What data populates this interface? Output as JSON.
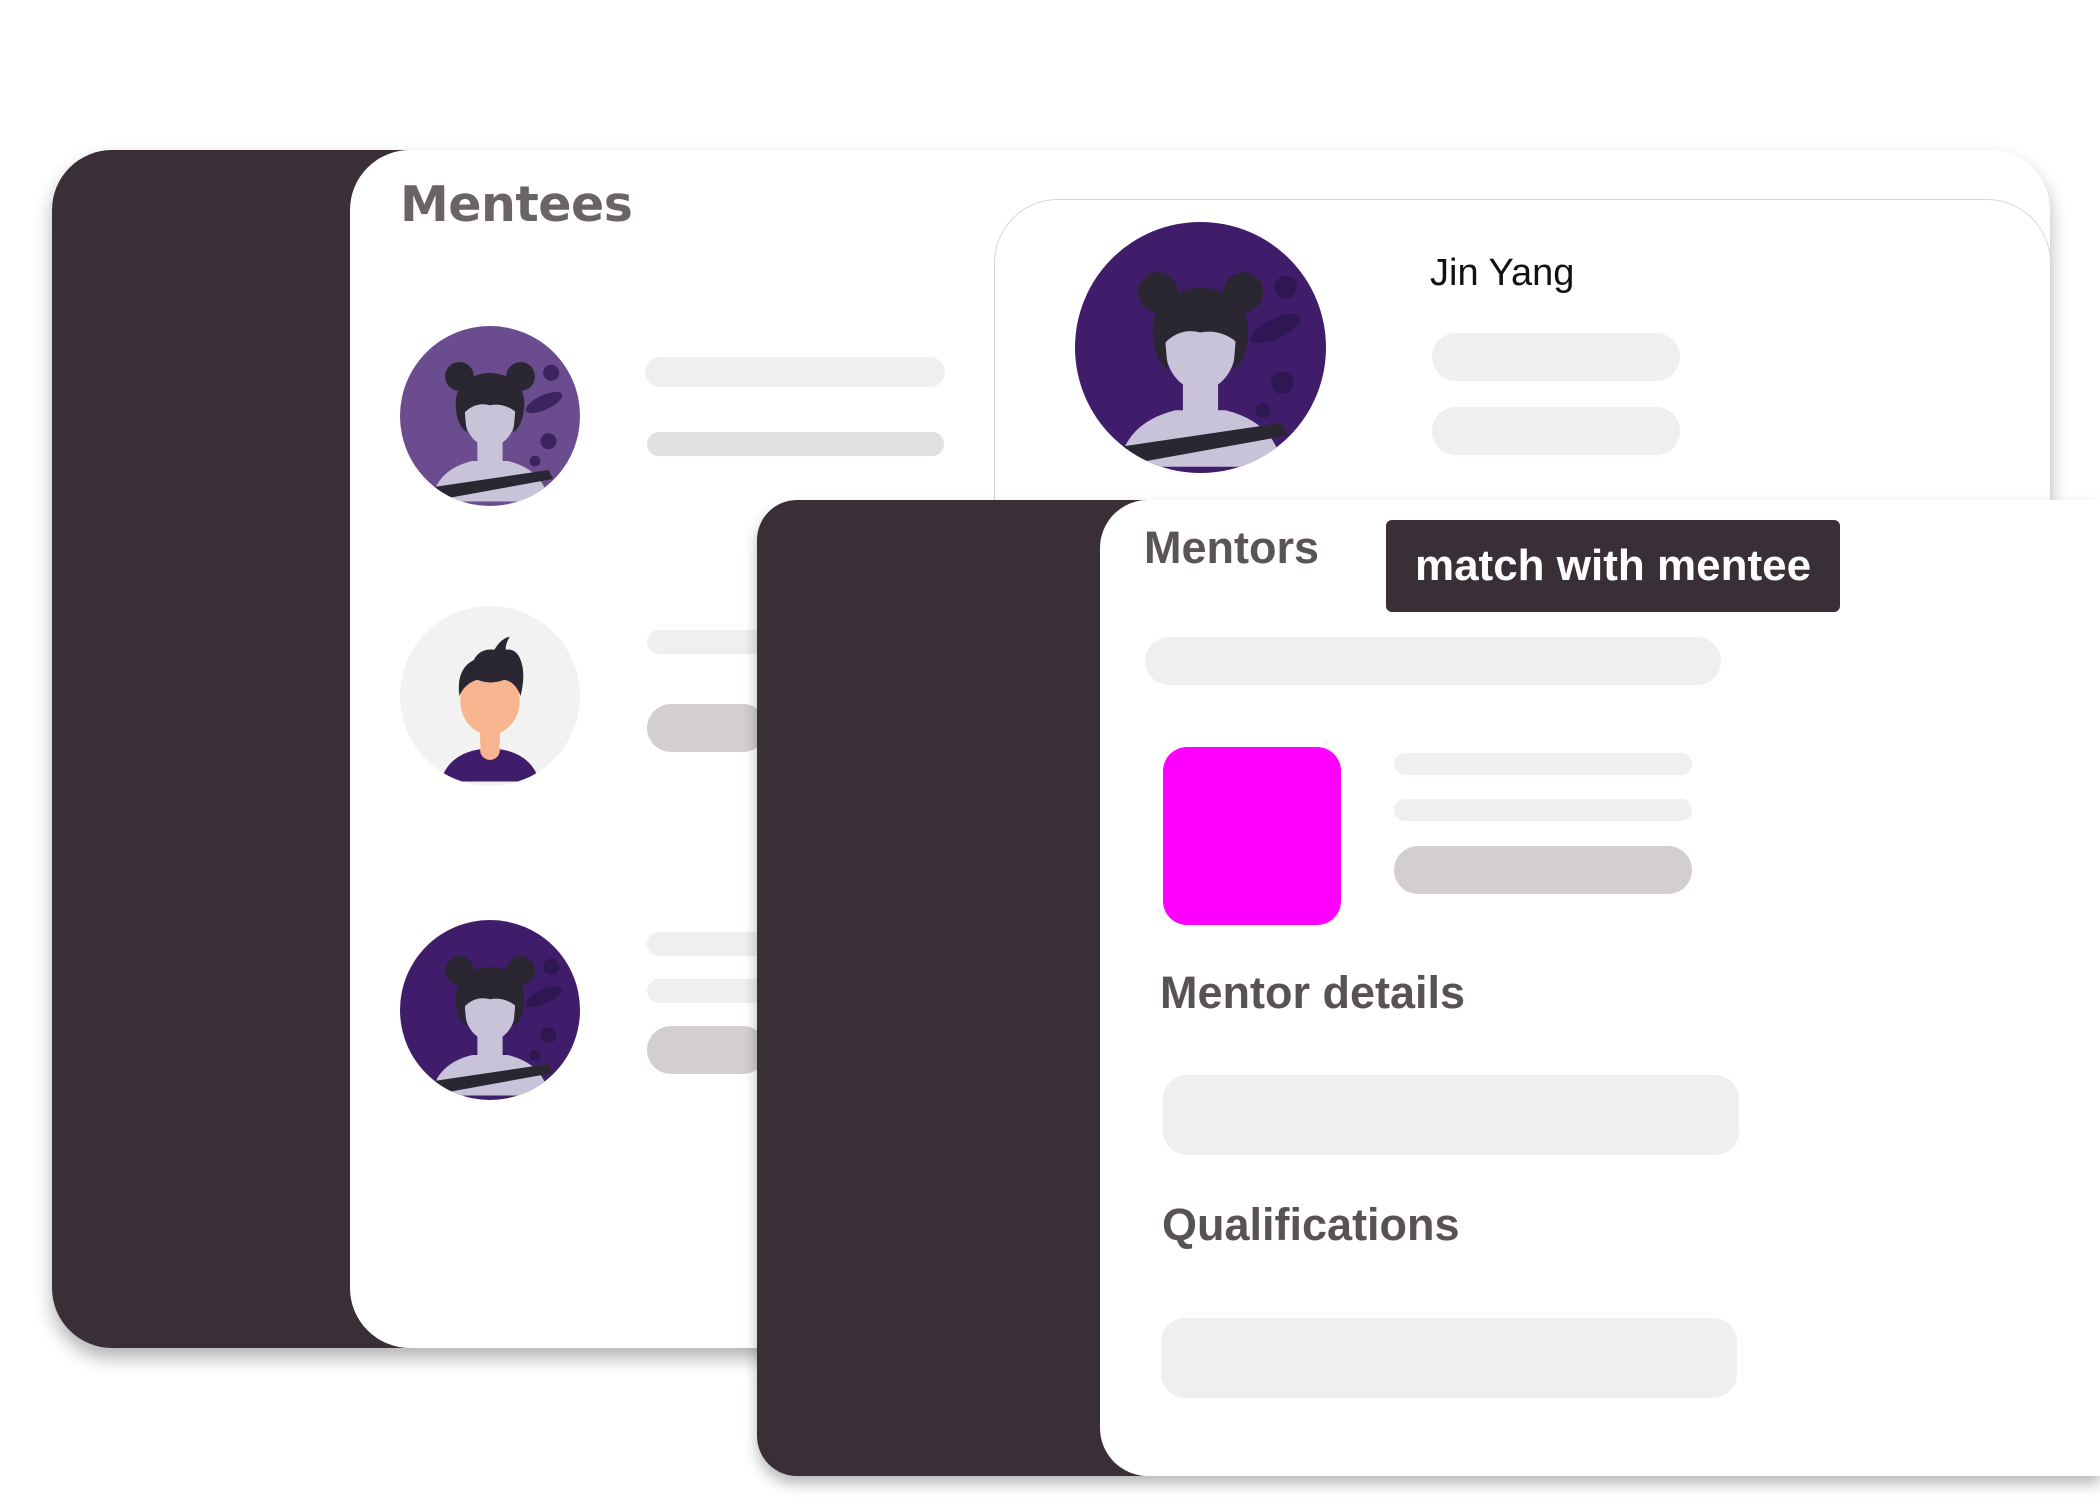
{
  "mentees_panel": {
    "title": "Mentees",
    "items": [
      {
        "avatar": "woman-buns-avatar"
      },
      {
        "avatar": "man-avatar"
      },
      {
        "avatar": "woman-buns-avatar"
      }
    ]
  },
  "detail_card": {
    "name": "Jin Yang",
    "avatar": "woman-buns-avatar"
  },
  "mentors_panel": {
    "title": "Mentors",
    "match_button": "match with mentee",
    "thumbnail_color": "#ff00ff",
    "sections": {
      "mentor_details": "Mentor details",
      "qualifications": "Qualifications"
    }
  },
  "colors": {
    "sidebar": "#3a2e37",
    "placeholder_light": "#f0eeef",
    "placeholder_dark": "#d3cfd0",
    "avatar_purple": "#3f1d6b",
    "avatar_purple_faded": "#6a4c8f"
  }
}
